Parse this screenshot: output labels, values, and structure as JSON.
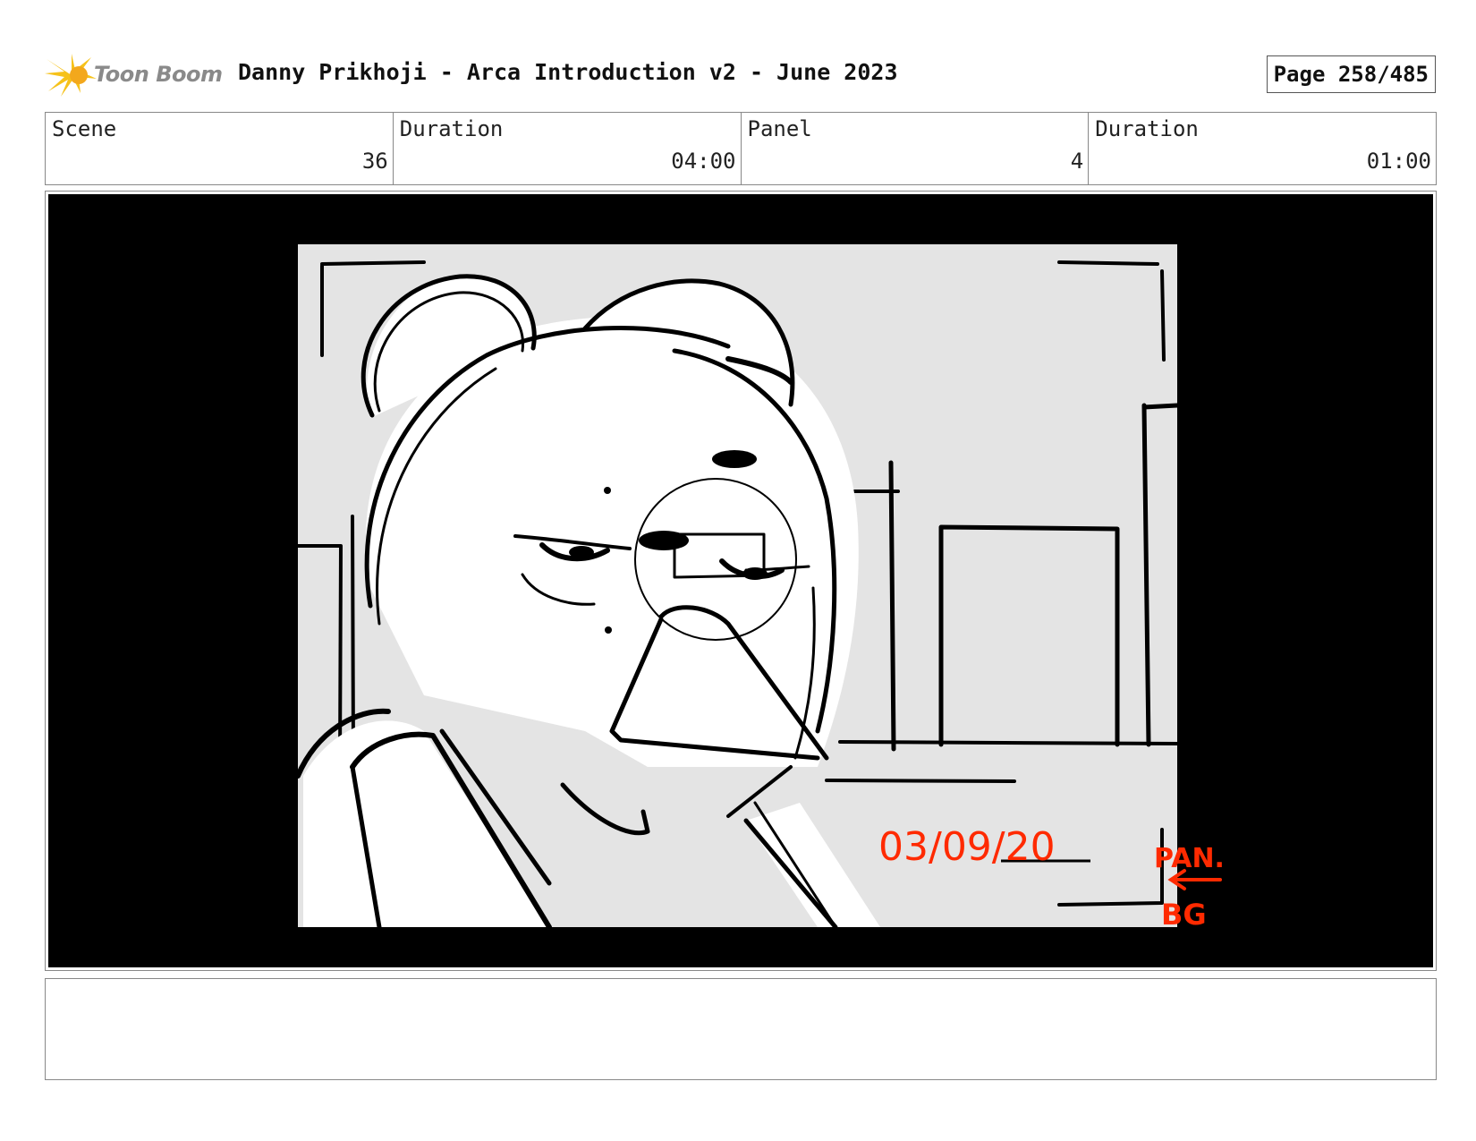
{
  "header": {
    "logo_text": "Toon Boom",
    "title": "Danny Prikhoji - Arca Introduction v2 - June 2023",
    "page": "Page 258/485"
  },
  "info": {
    "scene_label": "Scene",
    "scene_value": "36",
    "scene_duration_label": "Duration",
    "scene_duration_value": "04:00",
    "panel_label": "Panel",
    "panel_value": "4",
    "panel_duration_label": "Duration",
    "panel_duration_value": "01:00"
  },
  "panel": {
    "date_annotation": "03/09/20",
    "pan_note_line1": "PAN.",
    "pan_note_line2": "BG",
    "annotation_color": "#ff2a00"
  },
  "notes": {
    "text": ""
  }
}
